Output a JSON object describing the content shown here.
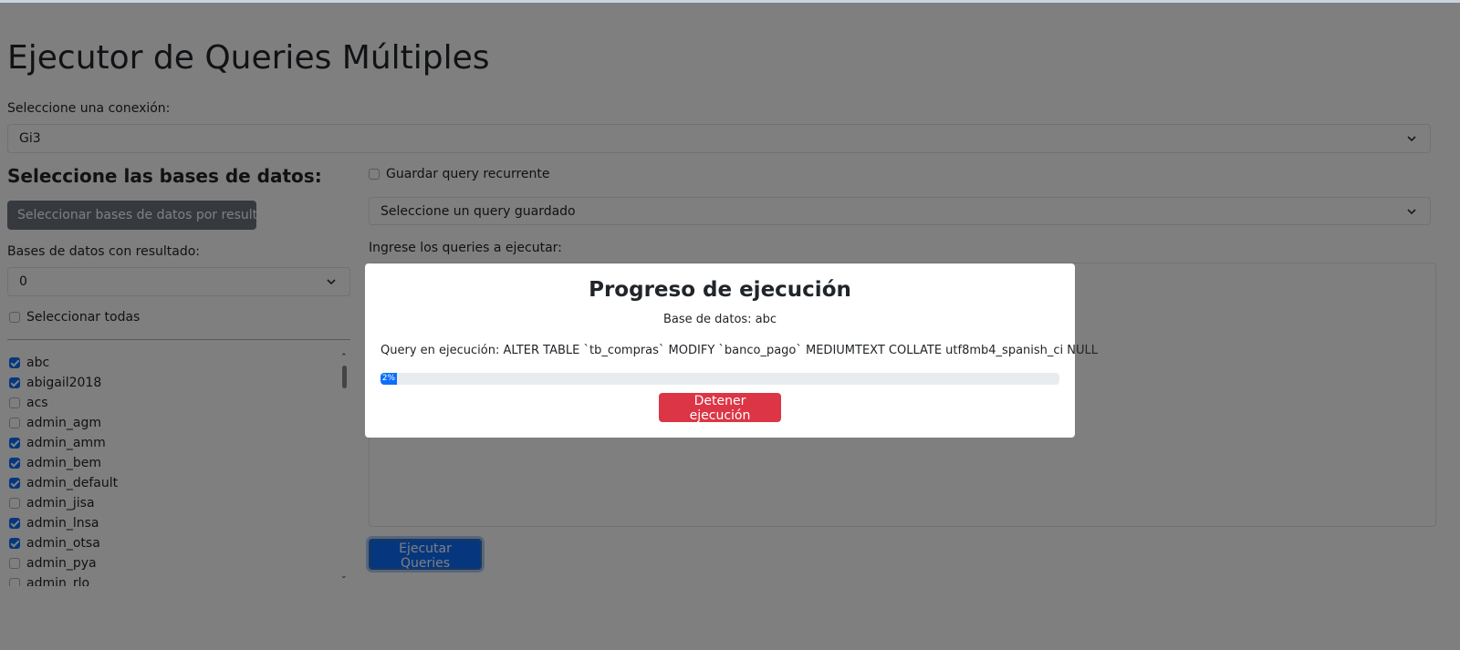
{
  "page": {
    "title": "Ejecutor de Queries Múltiples",
    "connection_label": "Seleccione una conexión:",
    "connection_value": "Gi3"
  },
  "left": {
    "heading": "Seleccione las bases de datos:",
    "select_by_result_button": "Seleccionar bases de datos por resultado",
    "result_label": "Bases de datos con resultado:",
    "result_value": "0",
    "select_all_label": "Seleccionar todas",
    "databases": [
      {
        "name": "abc",
        "checked": true
      },
      {
        "name": "abigail2018",
        "checked": true
      },
      {
        "name": "acs",
        "checked": false
      },
      {
        "name": "admin_agm",
        "checked": false
      },
      {
        "name": "admin_amm",
        "checked": true
      },
      {
        "name": "admin_bem",
        "checked": true
      },
      {
        "name": "admin_default",
        "checked": true
      },
      {
        "name": "admin_jisa",
        "checked": false
      },
      {
        "name": "admin_lnsa",
        "checked": true
      },
      {
        "name": "admin_otsa",
        "checked": true
      },
      {
        "name": "admin_pya",
        "checked": false
      },
      {
        "name": "admin_rlo",
        "checked": false
      }
    ]
  },
  "right": {
    "save_recurring_label": "Guardar query recurrente",
    "saved_query_placeholder": "Seleccione un query guardado",
    "queries_label": "Ingrese los queries a ejecutar:",
    "execute_button": "Ejecutar Queries"
  },
  "modal": {
    "title": "Progreso de ejecución",
    "database_text": "Base de datos: abc",
    "query_text": "Query en ejecución: ALTER TABLE `tb_compras` MODIFY `banco_pago` MEDIUMTEXT COLLATE utf8mb4_spanish_ci NULL",
    "progress_percent": 2,
    "progress_label": "2%",
    "stop_button": "Detener ejecución"
  },
  "colors": {
    "primary": "#0d6efd",
    "danger": "#dc3545",
    "secondary": "#6c757d"
  }
}
